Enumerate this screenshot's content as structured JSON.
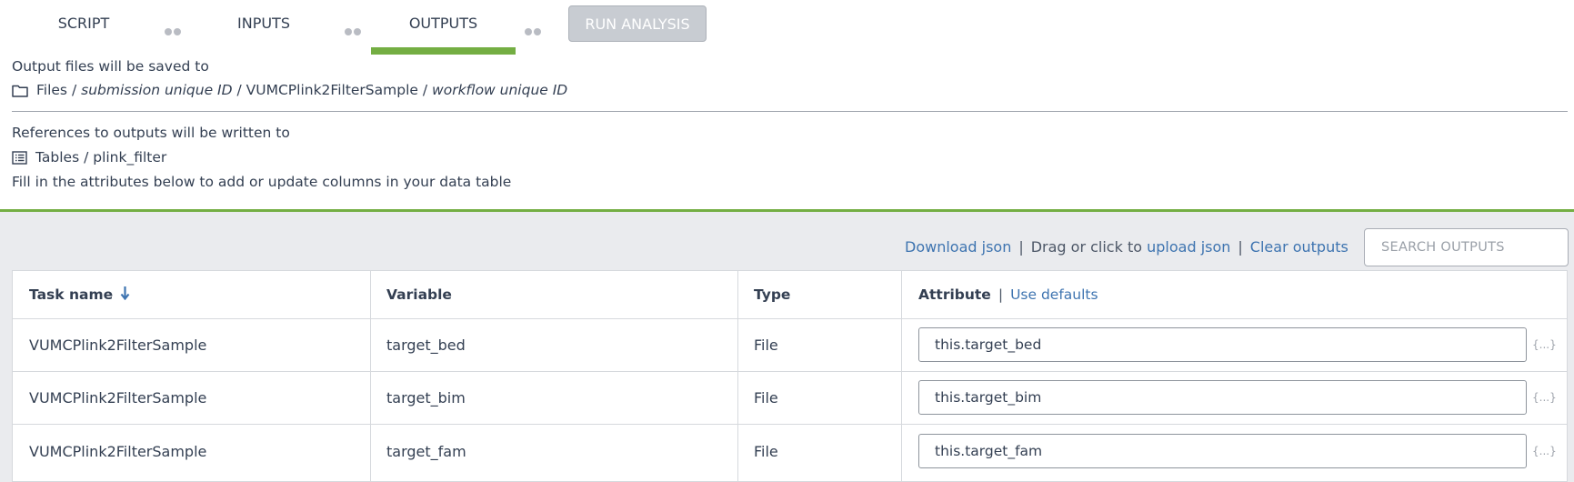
{
  "tabs": [
    {
      "label": "SCRIPT"
    },
    {
      "label": "INPUTS"
    },
    {
      "label": "OUTPUTS"
    }
  ],
  "run_button": {
    "label": "RUN ANALYSIS"
  },
  "output_files": {
    "heading": "Output files will be saved to",
    "path_root": "Files",
    "sep": "/",
    "submission": "submission unique ID",
    "workflow_name": "VUMCPlink2FilterSample",
    "workflow_id": "workflow unique ID"
  },
  "references": {
    "heading": "References to outputs will be written to",
    "path": "Tables / plink_filter",
    "hint": "Fill in the attributes below to add or update columns in your data table"
  },
  "toolbar": {
    "download": "Download json",
    "drag_text": "Drag or click to",
    "upload": "upload json",
    "clear": "Clear outputs",
    "pipe": "|",
    "search_placeholder": "SEARCH OUTPUTS"
  },
  "table": {
    "headers": {
      "task": "Task name",
      "variable": "Variable",
      "type": "Type",
      "attribute": "Attribute",
      "use_defaults": "Use defaults"
    },
    "rows": [
      {
        "task": "VUMCPlink2FilterSample",
        "variable": "target_bed",
        "type": "File",
        "attribute": "this.target_bed"
      },
      {
        "task": "VUMCPlink2FilterSample",
        "variable": "target_bim",
        "type": "File",
        "attribute": "this.target_bim"
      },
      {
        "task": "VUMCPlink2FilterSample",
        "variable": "target_fam",
        "type": "File",
        "attribute": "this.target_fam"
      }
    ],
    "expand_label": "{...}"
  },
  "colors": {
    "accent": "#74ae43",
    "link": "#3e74b0",
    "text": "#333f52"
  }
}
